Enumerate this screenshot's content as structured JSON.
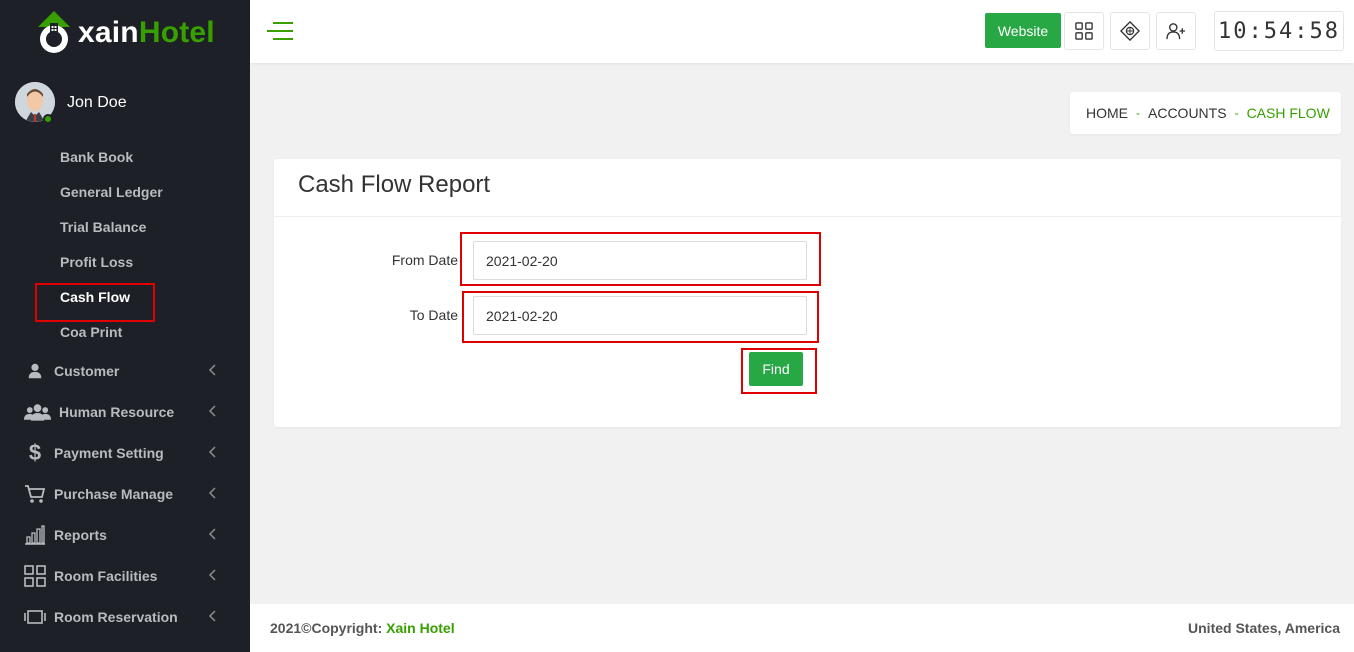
{
  "app": {
    "logo_text_prefix": "xain",
    "logo_text_accent": "Hotel",
    "brand_color": "#37a000",
    "button_green": "#28a745",
    "sidebar_bg": "#1d2127"
  },
  "user": {
    "name": "Jon Doe",
    "status": "online"
  },
  "sidebar": {
    "sub_items": [
      {
        "label": "Bank Book"
      },
      {
        "label": "General Ledger"
      },
      {
        "label": "Trial Balance"
      },
      {
        "label": "Profit Loss"
      },
      {
        "label": "Cash Flow",
        "active": true
      },
      {
        "label": "Coa Print"
      }
    ],
    "items": [
      {
        "label": "Customer",
        "icon": "user-icon"
      },
      {
        "label": "Human Resource",
        "icon": "users-icon"
      },
      {
        "label": "Payment Setting",
        "icon": "dollar-icon"
      },
      {
        "label": "Purchase Manage",
        "icon": "cart-icon"
      },
      {
        "label": "Reports",
        "icon": "bar-chart-icon"
      },
      {
        "label": "Room Facilities",
        "icon": "grid-icon"
      },
      {
        "label": "Room Reservation",
        "icon": "reservation-icon"
      }
    ]
  },
  "header": {
    "website_label": "Website",
    "clock": "10:54:58"
  },
  "breadcrumb": {
    "home": "HOME",
    "accounts": "ACCOUNTS",
    "current": "CASH FLOW",
    "separator": "-"
  },
  "report": {
    "title": "Cash Flow Report",
    "from_label": "From Date",
    "from_value": "2021-02-20",
    "to_label": "To Date",
    "to_value": "2021-02-20",
    "find_label": "Find"
  },
  "footer": {
    "copyright": "2021©Copyright:",
    "brand": "Xain Hotel",
    "location": "United States, America"
  }
}
